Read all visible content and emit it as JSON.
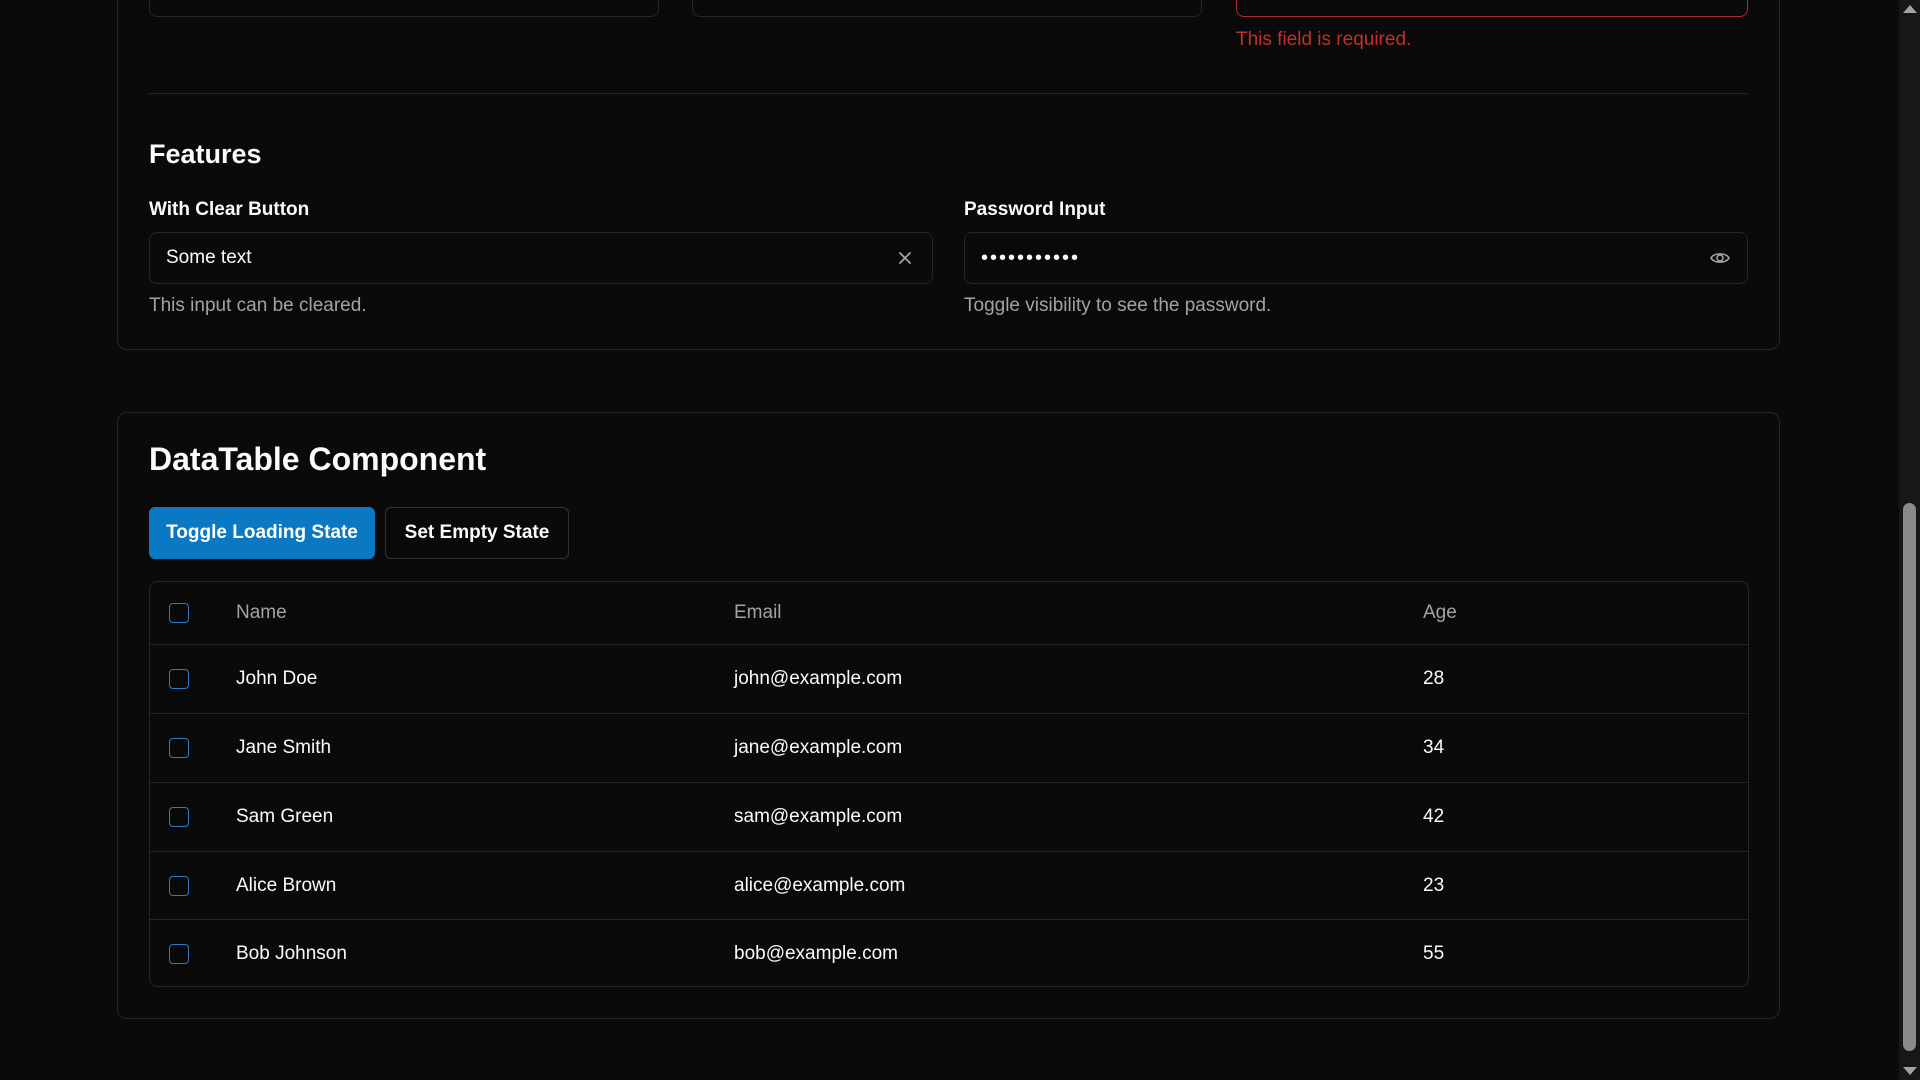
{
  "form_top": {
    "error_text": "This field is required."
  },
  "features": {
    "title": "Features",
    "clear_field": {
      "label": "With Clear Button",
      "value": "Some text",
      "helper": "This input can be cleared.",
      "icon": "close-icon"
    },
    "password_field": {
      "label": "Password Input",
      "value": "•••••••••••",
      "helper": "Toggle visibility to see the password.",
      "icon": "eye-icon"
    }
  },
  "datatable": {
    "title": "DataTable Component",
    "buttons": {
      "toggle_loading": "Toggle Loading State",
      "set_empty": "Set Empty State"
    },
    "columns": [
      "Name",
      "Email",
      "Age"
    ],
    "rows": [
      {
        "name": "John Doe",
        "email": "john@example.com",
        "age": "28"
      },
      {
        "name": "Jane Smith",
        "email": "jane@example.com",
        "age": "34"
      },
      {
        "name": "Sam Green",
        "email": "sam@example.com",
        "age": "42"
      },
      {
        "name": "Alice Brown",
        "email": "alice@example.com",
        "age": "23"
      },
      {
        "name": "Bob Johnson",
        "email": "bob@example.com",
        "age": "55"
      }
    ]
  },
  "colors": {
    "accent": "#0b78c4",
    "error": "#c1302b",
    "background": "#0a0a0a",
    "border": "#262626"
  }
}
